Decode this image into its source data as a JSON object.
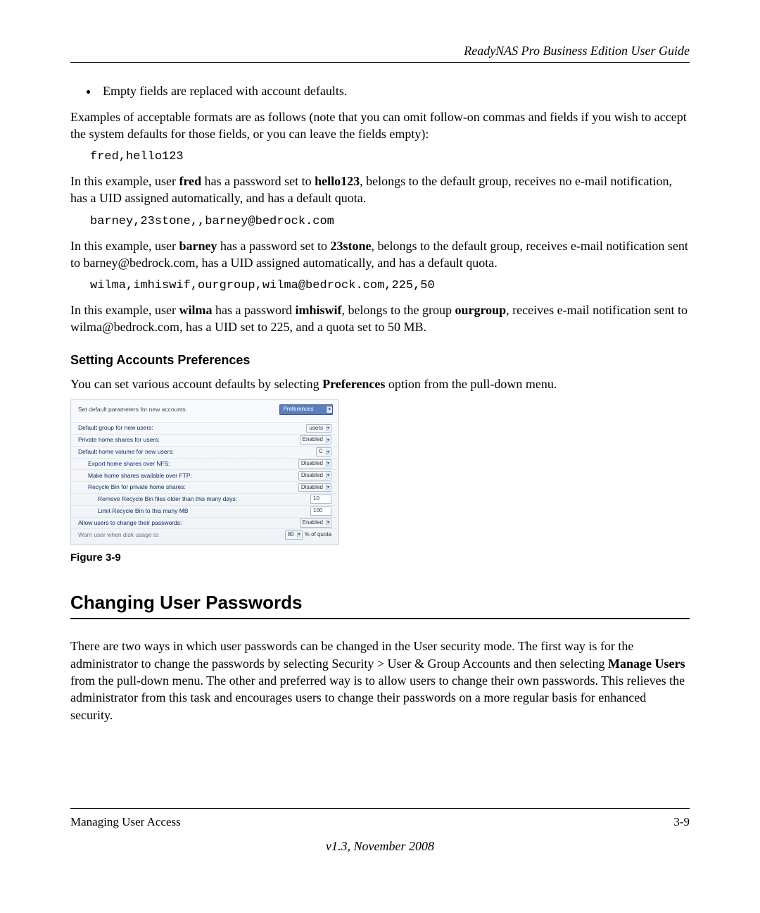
{
  "header": {
    "title": "ReadyNAS Pro Business Edition User Guide"
  },
  "bullet1": "Empty fields are replaced with account defaults.",
  "para_examples_intro": "Examples of acceptable formats are as follows (note that you can omit follow-on commas and fields if you wish to accept the system defaults for those fields, or you can leave the fields empty):",
  "code1": "fred,hello123",
  "para_fred_a": "In this example, user ",
  "para_fred_b": " has a password set to ",
  "para_fred_c": ", belongs to the default group, receives no e-mail notification, has a UID assigned automatically, and has a default quota.",
  "bold_fred": "fred",
  "bold_hello123": "hello123",
  "code2": "barney,23stone,,barney@bedrock.com",
  "para_barney_a": "In this example, user ",
  "para_barney_b": " has a password set to ",
  "para_barney_c": ", belongs to the default group, receives e-mail notification sent to barney@bedrock.com, has a UID assigned automatically, and has a default quota.",
  "bold_barney": "barney",
  "bold_23stone": "23stone",
  "code3": "wilma,imhiswif,ourgroup,wilma@bedrock.com,225,50",
  "para_wilma_a": "In this example, user ",
  "para_wilma_b": " has a password ",
  "para_wilma_c": ", belongs to the group ",
  "para_wilma_d": ", receives e-mail notification sent to wilma@bedrock.com, has a UID set to 225, and a quota set to 50 MB.",
  "bold_wilma": "wilma",
  "bold_imhiswif": "imhiswif",
  "bold_ourgroup": "ourgroup",
  "heading3": "Setting Accounts Preferences",
  "para_prefs_a": "You can set various account defaults by selecting ",
  "para_prefs_b": " option from the pull-down menu.",
  "bold_preferences": "Preferences",
  "fig": {
    "top_text": "Set default parameters for new accounts.",
    "pref_label": "Preferences",
    "rows": [
      {
        "label": "Default group for new users:",
        "value": "users",
        "type": "sel",
        "indent": 0
      },
      {
        "label": "Private home shares for users:",
        "value": "Enabled",
        "type": "sel",
        "indent": 0
      },
      {
        "label": "Default home volume for new users:",
        "value": "C",
        "type": "sel",
        "indent": 0
      },
      {
        "label": "Export home shares over NFS:",
        "value": "Disabled",
        "type": "sel",
        "indent": 1
      },
      {
        "label": "Make home shares available over FTP:",
        "value": "Disabled",
        "type": "sel",
        "indent": 1
      },
      {
        "label": "Recycle Bin for private home shares:",
        "value": "Disabled",
        "type": "sel",
        "indent": 1
      },
      {
        "label": "Remove Recycle Bin files older than this many days:",
        "value": "10",
        "type": "inp",
        "indent": 2
      },
      {
        "label": "Limit Recycle Bin to this many MB",
        "value": "100",
        "type": "inp",
        "indent": 2
      },
      {
        "label": "Allow users to change their passwords:",
        "value": "Enabled",
        "type": "sel",
        "indent": 0
      },
      {
        "label": "Warn user when disk usage is:",
        "value": "80",
        "type": "sel",
        "suffix": "% of quota",
        "indent": 0,
        "muted": true
      }
    ]
  },
  "figure_caption": "Figure 3-9",
  "heading2": "Changing User Passwords",
  "para_changing_a": "There are two ways in which user passwords can be changed in the User security mode. The first way is for the administrator to change the passwords by selecting Security > User & Group Accounts and then selecting ",
  "bold_manage_users": "Manage Users",
  "para_changing_b": " from the pull-down menu. The other and preferred way is to allow users to change their own passwords. This relieves the administrator from this task and encourages users to change their passwords on a more regular basis for enhanced security.",
  "footer": {
    "left": "Managing User Access",
    "right": "3-9",
    "center": "v1.3, November 2008"
  }
}
